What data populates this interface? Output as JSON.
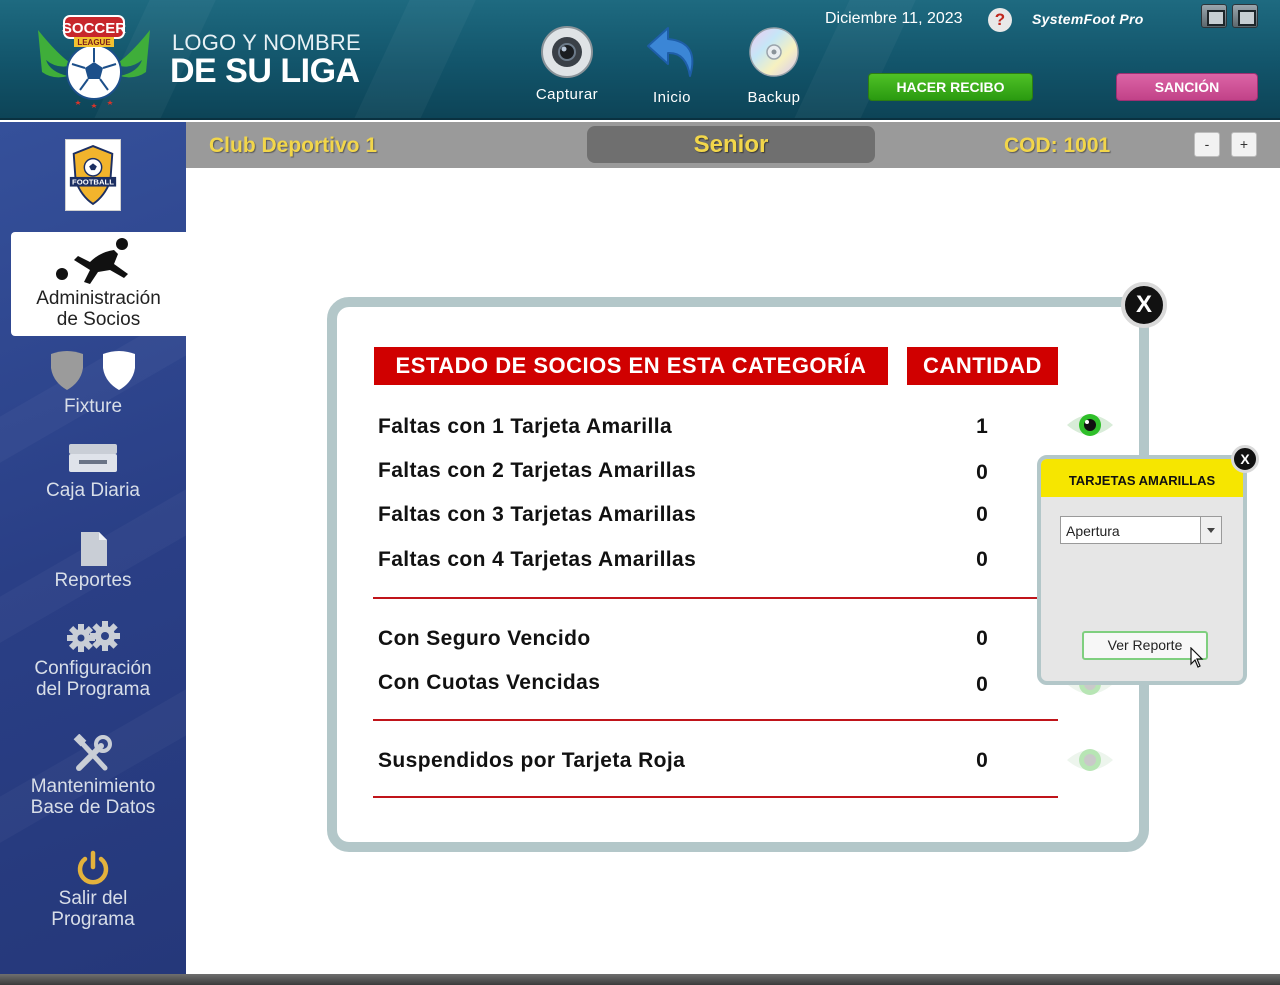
{
  "header": {
    "league_name_line1": "LOGO Y NOMBRE",
    "league_name_line2": "DE SU LIGA",
    "logo_text_top": "SOCCER",
    "logo_text_ribbon": "LEAGUE",
    "toolbar": [
      {
        "label": "Capturar",
        "icon": "camera-icon"
      },
      {
        "label": "Inicio",
        "icon": "back-arrow-icon"
      },
      {
        "label": "Backup",
        "icon": "disc-icon"
      }
    ],
    "date": "Diciembre 11, 2023",
    "help_glyph": "?",
    "brand": "SystemFoot Pro",
    "recibo_button": "HACER RECIBO",
    "sancion_button": "SANCIÓN",
    "recibo_color": "#3bb01a",
    "sancion_color": "#d255a0"
  },
  "sidebar": {
    "club_logo_text": "FOOTBALL",
    "items": [
      {
        "label_1": "Administración",
        "label_2": "de Socios",
        "icon": "player-kick-icon",
        "active": true
      },
      {
        "label_1": "Fixture",
        "icon": "shields-icon"
      },
      {
        "label_1": "Caja Diaria",
        "icon": "cash-drawer-icon"
      },
      {
        "label_1": "Reportes",
        "icon": "document-icon"
      },
      {
        "label_1": "Configuración",
        "label_2": "del Programa",
        "icon": "gears-icon"
      },
      {
        "label_1": "Mantenimiento",
        "label_2": "Base de Datos",
        "icon": "tools-icon"
      },
      {
        "label_1": "Salir del",
        "label_2": "Programa",
        "icon": "power-icon"
      }
    ]
  },
  "clubbar": {
    "club_name": "Club Deportivo 1",
    "category": "Senior",
    "code": "COD: 1001",
    "zoom_out": "-",
    "zoom_in": "+"
  },
  "panel": {
    "header_status": "ESTADO DE SOCIOS EN ESTA CATEGORÍA",
    "header_count": "CANTIDAD",
    "close": "X",
    "rows": [
      {
        "label": "Faltas con 1 Tarjeta Amarilla",
        "count": "1",
        "eye_active": true
      },
      {
        "label": "Faltas con 2 Tarjetas Amarillas",
        "count": "0"
      },
      {
        "label": "Faltas con 3 Tarjetas Amarillas",
        "count": "0"
      },
      {
        "label": "Faltas con 4 Tarjetas Amarillas",
        "count": "0"
      },
      {
        "label": "Con Seguro Vencido",
        "count": "0"
      },
      {
        "label": "Con Cuotas Vencidas",
        "count": "0"
      },
      {
        "label": "Suspendidos por Tarjeta Roja",
        "count": "0"
      }
    ],
    "accent_red": "#d00000"
  },
  "popup": {
    "title": "TARJETAS AMARILLAS",
    "close": "X",
    "select_value": "Apertura",
    "button": "Ver Reporte",
    "title_color": "#f6e600"
  }
}
